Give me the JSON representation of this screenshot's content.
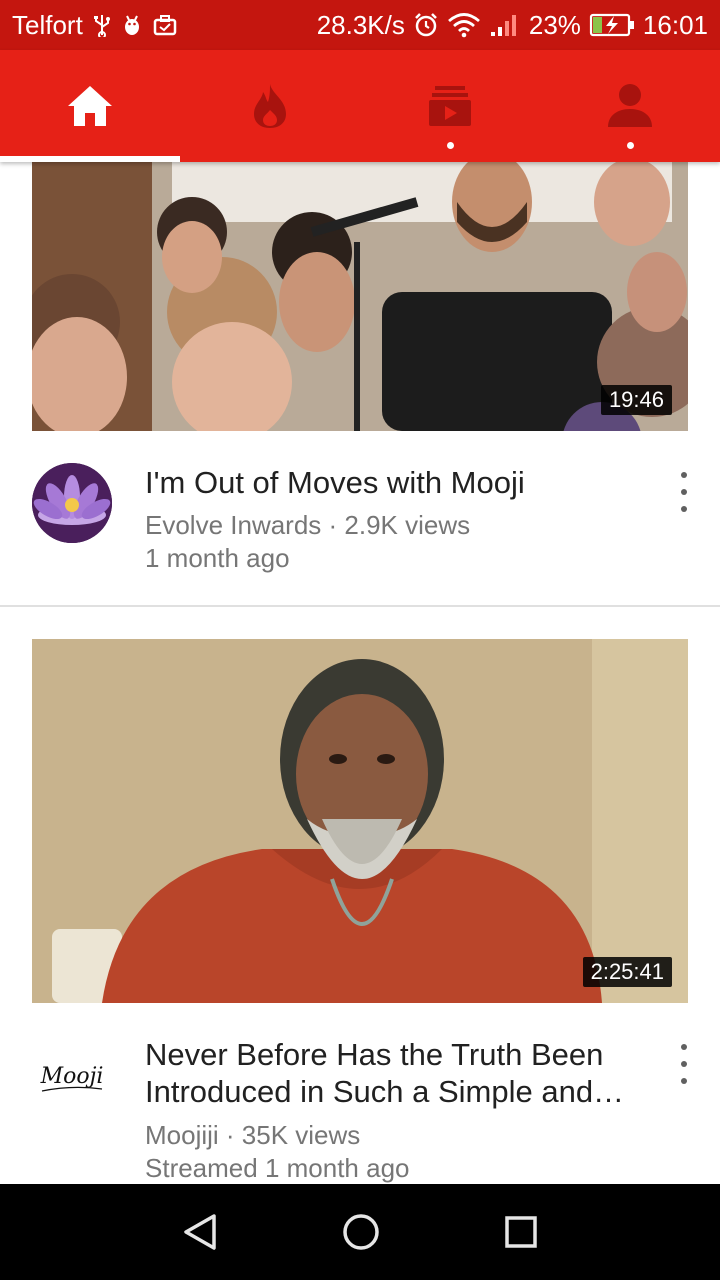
{
  "status_bar": {
    "carrier": "Telfort",
    "net_speed": "28.3K/s",
    "battery": "23%",
    "time": "16:01",
    "icons": [
      "usb-icon",
      "android-debug-icon",
      "briefcase-icon",
      "alarm-icon",
      "wifi-icon",
      "signal-icon",
      "battery-charging-icon"
    ]
  },
  "app_bar": {
    "tabs": [
      {
        "name": "home",
        "icon": "home-icon",
        "selected": true
      },
      {
        "name": "trending",
        "icon": "flame-icon",
        "selected": false
      },
      {
        "name": "subscriptions",
        "icon": "subscriptions-icon",
        "selected": false,
        "has_dot": true
      },
      {
        "name": "account",
        "icon": "account-icon",
        "selected": false,
        "has_dot": true
      }
    ],
    "colors": {
      "bar": "#e62117",
      "status": "#c4160f",
      "inactive_icon": "#b31010"
    }
  },
  "videos": [
    {
      "duration": "19:46",
      "title": "I'm Out of Moves with Mooji",
      "channel_line": "Evolve Inwards · 2.9K views",
      "age": "1 month ago",
      "avatar": "lotus-avatar"
    },
    {
      "duration": "2:25:41",
      "title_line1": "Never Before Has the Truth Been",
      "title_line2": "Introduced in Such a Simple and…",
      "channel_line": "Moojiji · 35K views",
      "age": "Streamed 1 month ago",
      "avatar_text": "Mooji"
    }
  ],
  "nav_bar": {
    "buttons": [
      "back-icon",
      "home-circle-icon",
      "recents-icon"
    ]
  }
}
